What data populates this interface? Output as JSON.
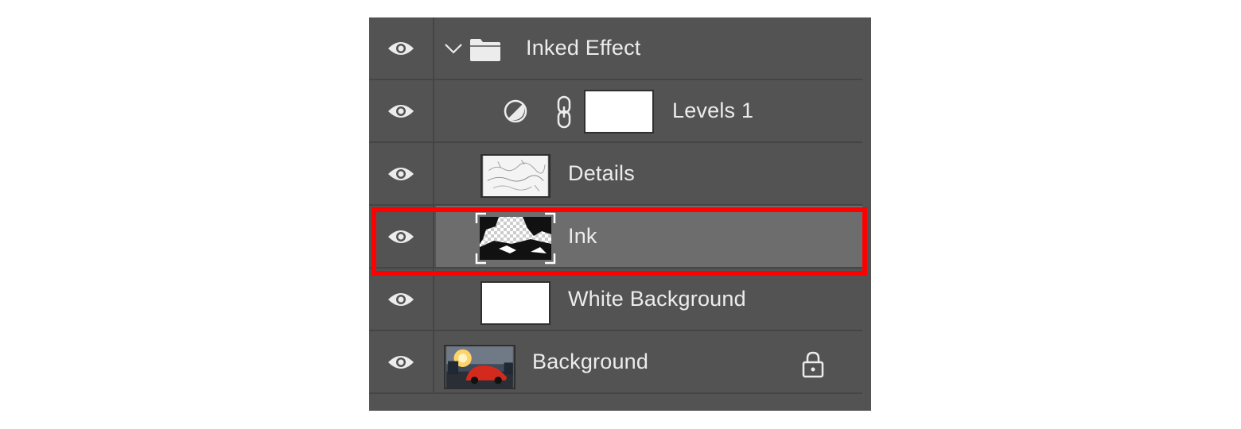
{
  "layers_panel": {
    "layers": [
      {
        "name": "Inked Effect",
        "kind": "group",
        "expanded": true,
        "visible": true
      },
      {
        "name": "Levels 1",
        "kind": "adjustment",
        "visible": true
      },
      {
        "name": "Details",
        "kind": "pixel",
        "visible": true
      },
      {
        "name": "Ink",
        "kind": "pixel",
        "visible": true,
        "selected": true
      },
      {
        "name": "White Background",
        "kind": "pixel",
        "visible": true
      },
      {
        "name": "Background",
        "kind": "background",
        "visible": true,
        "locked": true
      }
    ]
  },
  "colors": {
    "panel_bg": "#535353",
    "selected_row_bg": "#6d6d6d",
    "highlight_outline": "#ff0000",
    "text": "#ececec"
  }
}
